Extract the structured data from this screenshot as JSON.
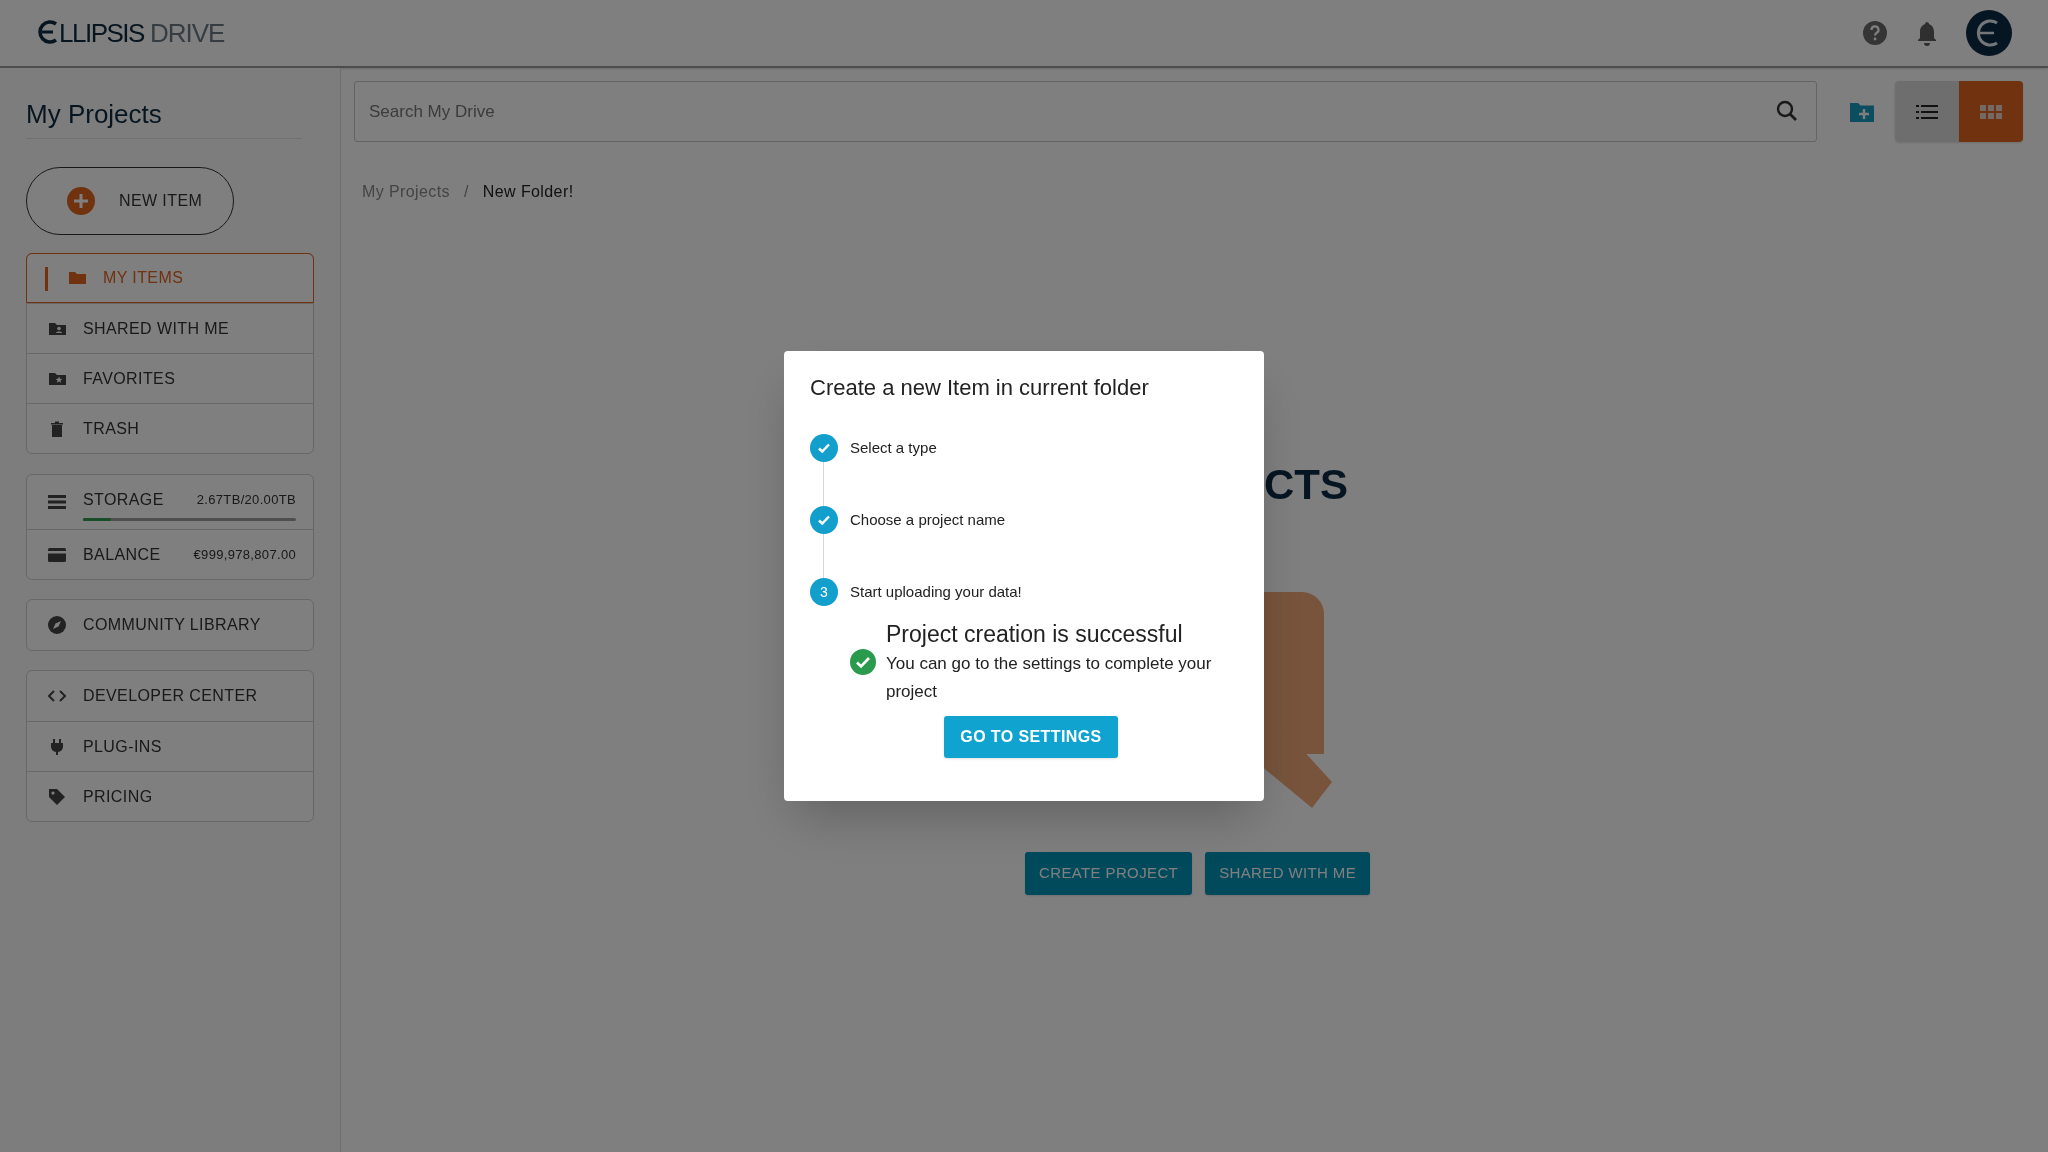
{
  "header": {
    "logo": {
      "word": "LLIPSIS",
      "suffix": "DRIVE"
    }
  },
  "sidebar": {
    "title": "My Projects",
    "new_item": "NEW ITEM",
    "nav": [
      {
        "label": "MY ITEMS",
        "selected": true
      },
      {
        "label": "SHARED WITH ME",
        "selected": false
      },
      {
        "label": "FAVORITES",
        "selected": false
      },
      {
        "label": "TRASH",
        "selected": false
      }
    ],
    "storage": {
      "label": "STORAGE",
      "value": "2.67TB/20.00TB",
      "level": 0.13
    },
    "balance": {
      "label": "BALANCE",
      "value": "€999,978,807.00"
    },
    "community": {
      "label": "COMMUNITY LIBRARY"
    },
    "links": [
      {
        "label": "DEVELOPER CENTER"
      },
      {
        "label": "PLUG-INS"
      },
      {
        "label": "PRICING"
      }
    ]
  },
  "search": {
    "placeholder": "Search My Drive"
  },
  "view_toggle": [
    {
      "selected": false
    },
    {
      "selected": true
    }
  ],
  "breadcrumb": {
    "separator": "/",
    "items": [
      {
        "label": "My Projects",
        "current": false
      },
      {
        "label": "New Folder!",
        "current": true
      }
    ]
  },
  "background": {
    "heading": "CTS",
    "buttons": [
      "CREATE PROJECT",
      "SHARED WITH ME"
    ]
  },
  "dialog": {
    "title": "Create a new Item in current folder",
    "steps": [
      {
        "label": "Select a type",
        "done": true
      },
      {
        "label": "Choose a project name",
        "done": true
      },
      {
        "label": "Start uploading your data!",
        "done": false,
        "number": "3"
      }
    ],
    "success": {
      "title": "Project creation is successful",
      "message": "You can go to the settings to complete your project",
      "button": "GO TO SETTINGS"
    }
  }
}
